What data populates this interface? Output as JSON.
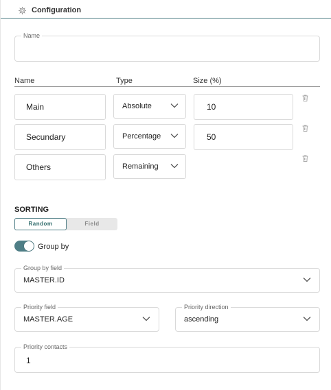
{
  "header": {
    "title": "Configuration",
    "icon": "gear-icon"
  },
  "name_field": {
    "label": "Name",
    "value": ""
  },
  "table": {
    "headers": [
      "Name",
      "Type",
      "Size (%)"
    ],
    "rows": [
      {
        "name": "Main",
        "type": "Absolute",
        "size": "10"
      },
      {
        "name": "Secundary",
        "type": "Percentage",
        "size": "50"
      },
      {
        "name": "Others",
        "type": "Remaining",
        "size": ""
      }
    ]
  },
  "sorting": {
    "title": "SORTING",
    "options": [
      "Random",
      "Field"
    ],
    "selected": "Random"
  },
  "group_by": {
    "label": "Group by",
    "enabled": true
  },
  "group_by_field": {
    "label": "Group by field",
    "value": "MASTER.ID"
  },
  "priority_field": {
    "label": "Priority field",
    "value": "MASTER.AGE"
  },
  "priority_direction": {
    "label": "Priority direction",
    "value": "ascending"
  },
  "priority_contacts": {
    "label": "Priority contacts",
    "value": "1"
  },
  "colors": {
    "accent": "#4f7e86",
    "border": "#d9d9d9"
  }
}
